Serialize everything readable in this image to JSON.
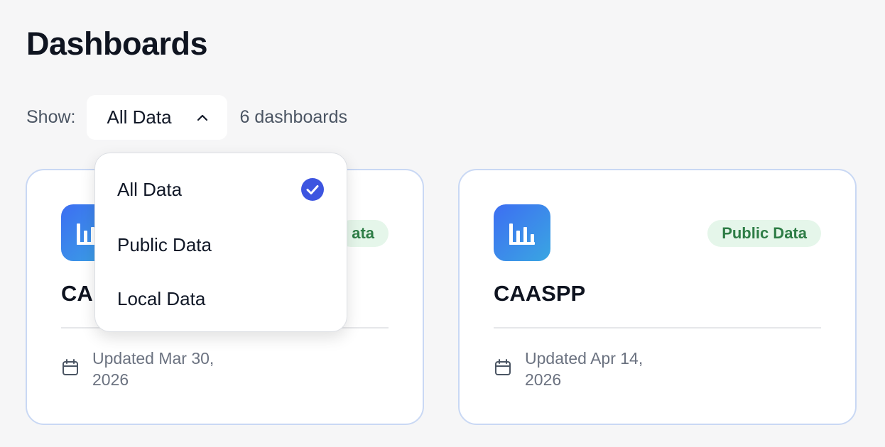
{
  "page": {
    "title": "Dashboards"
  },
  "filter": {
    "show_label": "Show:",
    "selected": "All Data",
    "count_text": "6 dashboards",
    "options": [
      {
        "label": "All Data",
        "selected": true
      },
      {
        "label": "Public Data",
        "selected": false
      },
      {
        "label": "Local Data",
        "selected": false
      }
    ]
  },
  "cards": [
    {
      "title": "CA",
      "badge": "ata",
      "updated": "Updated Mar 30, 2026",
      "icon": "bar-chart-icon"
    },
    {
      "title": "CAASPP",
      "badge": "Public Data",
      "updated": "Updated Apr 14, 2026",
      "icon": "bar-chart-icon"
    }
  ],
  "colors": {
    "accent": "#3d55e0",
    "badge_bg": "#e5f6ea",
    "badge_text": "#2e7d46",
    "card_border": "#c9d8f4",
    "icon_gradient_start": "#3d6ef2",
    "icon_gradient_end": "#3aa6e2"
  }
}
